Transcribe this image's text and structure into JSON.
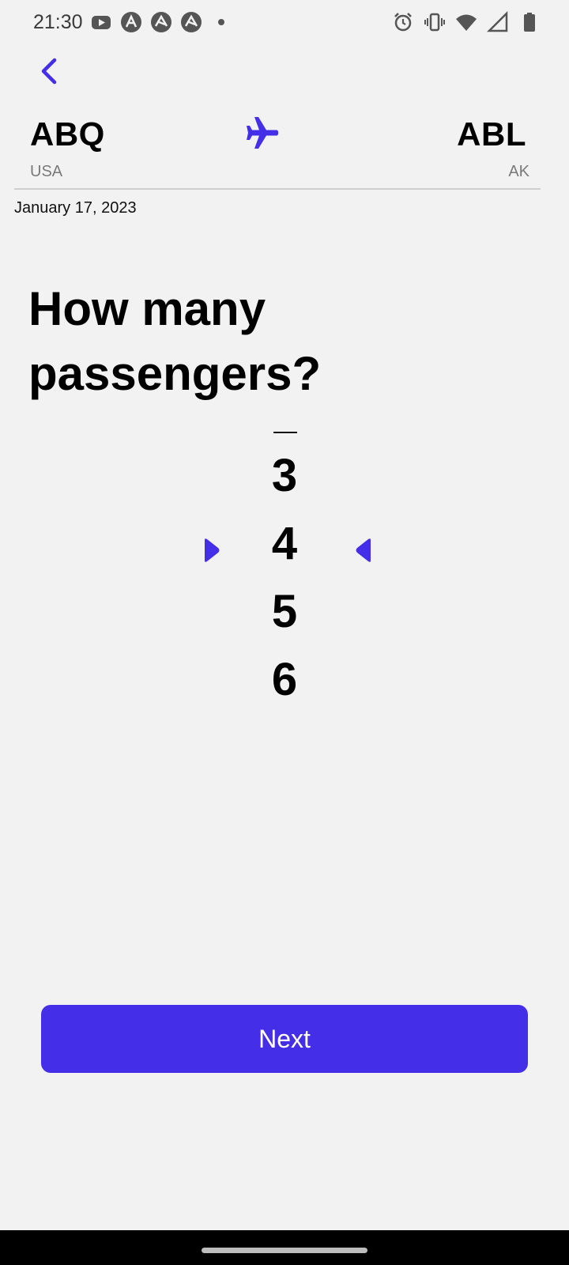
{
  "status_bar": {
    "time": "21:30",
    "left_icons": [
      "youtube-icon",
      "app-icon",
      "app-icon",
      "app-icon",
      "dot-icon"
    ],
    "right_icons": [
      "alarm-icon",
      "vibrate-icon",
      "wifi-icon",
      "signal-icon",
      "battery-icon"
    ]
  },
  "route": {
    "origin_code": "ABQ",
    "origin_sub": "USA",
    "destination_code": "ABL",
    "destination_sub": "AK"
  },
  "flight_date": "January 17, 2023",
  "question": "How many passengers?",
  "picker": {
    "values": [
      "3",
      "4",
      "5",
      "6"
    ],
    "selected": "4"
  },
  "next_label": "Next",
  "colors": {
    "accent": "#452ee8",
    "background": "#f2f2f2"
  }
}
